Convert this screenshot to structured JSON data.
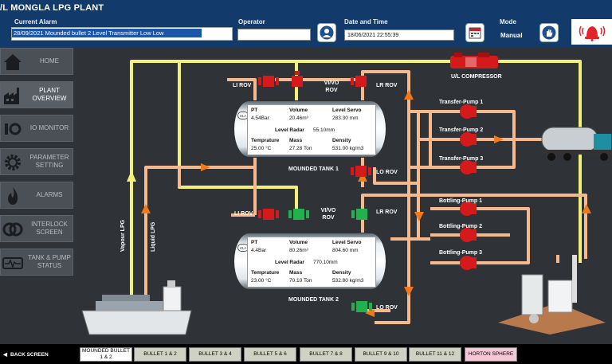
{
  "header": {
    "title": "/L MONGLA LPG PLANT",
    "current_alarm_label": "Current Alarm",
    "current_alarm_value": "28/09/2021    Mounded bullet 2  Level Transmitter Low Low",
    "operator_label": "Operator",
    "operator_value": "",
    "datetime_label": "Date and Time",
    "datetime_value": "18/06/2021 22:55:39",
    "mode_label": "Mode",
    "mode_value": "Manual"
  },
  "sidebar": {
    "items": [
      {
        "label": "HOME",
        "icon": "home-icon"
      },
      {
        "label": "PLANT OVERVIEW",
        "icon": "factory-icon"
      },
      {
        "label": "IO MONITOR",
        "icon": "io-icon"
      },
      {
        "label": "PARAMETER SETTING",
        "icon": "gear-icon"
      },
      {
        "label": "ALARMS",
        "icon": "flame-icon"
      },
      {
        "label": "INTERLOCK SCREEN",
        "icon": "interlock-icon"
      },
      {
        "label": "TANK & PUMP STATUS",
        "icon": "pulse-icon"
      }
    ]
  },
  "tank1": {
    "name": "MOUNDED TANK 1",
    "pt_label": "PT",
    "pt_value": "4.54Bar",
    "volume_label": "Volume",
    "volume_value": "20.46m³",
    "level_servo_label": "Level Servo",
    "level_servo_value": "283.30 mm",
    "level_radar_label": "Level Radar",
    "level_radar_value": "55.10mm",
    "temp_label": "Temprature",
    "temp_value": "25.00 °C",
    "mass_label": "Mass",
    "mass_value": "27.28 Ton",
    "density_label": "Density",
    "density_value": "531.00 kg/m3",
    "hla": "HLA"
  },
  "tank2": {
    "name": "MOUNDED TANK 2",
    "pt_label": "PT",
    "pt_value": "4.4Bar",
    "volume_label": "Volume",
    "volume_value": "80.26m³",
    "level_servo_label": "Level Servo",
    "level_servo_value": "804.60 mm",
    "level_radar_label": "Level Radar",
    "level_radar_value": "770.10mm",
    "temp_label": "Temprature",
    "temp_value": "23.00 °C",
    "mass_label": "Mass",
    "mass_value": "70.10 Ton",
    "density_label": "Density",
    "density_value": "532.80 kg/m3",
    "hla": "HLA"
  },
  "valves": {
    "li_rov_1": "LI ROV",
    "vivo_rov_1": "VI/VO ROV",
    "lr_rov_1": "LR ROV",
    "lo_rov_1": "LO ROV",
    "li_rov_2": "LI ROV",
    "vivo_rov_2": "VI/VO ROV",
    "lr_rov_2": "LR ROV",
    "lo_rov_2": "LO ROV"
  },
  "lines": {
    "vapour": "Vapour LPG",
    "liquid": "Liquid LPG",
    "compressor": "U/L COMPRESSOR"
  },
  "pumps": {
    "transfer": [
      "Transfer-Pump 1",
      "Transfer-Pump 2",
      "Transfer-Pump 3"
    ],
    "bottling": [
      "Bottling-Pump 1",
      "Bottling-Pump 2",
      "Bottling-Pump 3"
    ]
  },
  "bottom": {
    "back": "BACK SCREEN",
    "tabs": [
      "MOUNDED BULLET 1 & 2",
      "BULLET 1 & 2",
      "BULLET 3 & 4",
      "BULLET 5 & 6",
      "BULLET 7 & 8",
      "BULLET 9 & 10",
      "BULLET 11 & 12",
      "HORTON SPHERE"
    ]
  },
  "colors": {
    "header": "#123a6b",
    "vapour_pipe": "#f3f07a",
    "liquid_pipe": "#f6b98e",
    "valve_red": "#d41a1a",
    "valve_green": "#22b14c",
    "flow_arrow": "#f07a1a"
  }
}
